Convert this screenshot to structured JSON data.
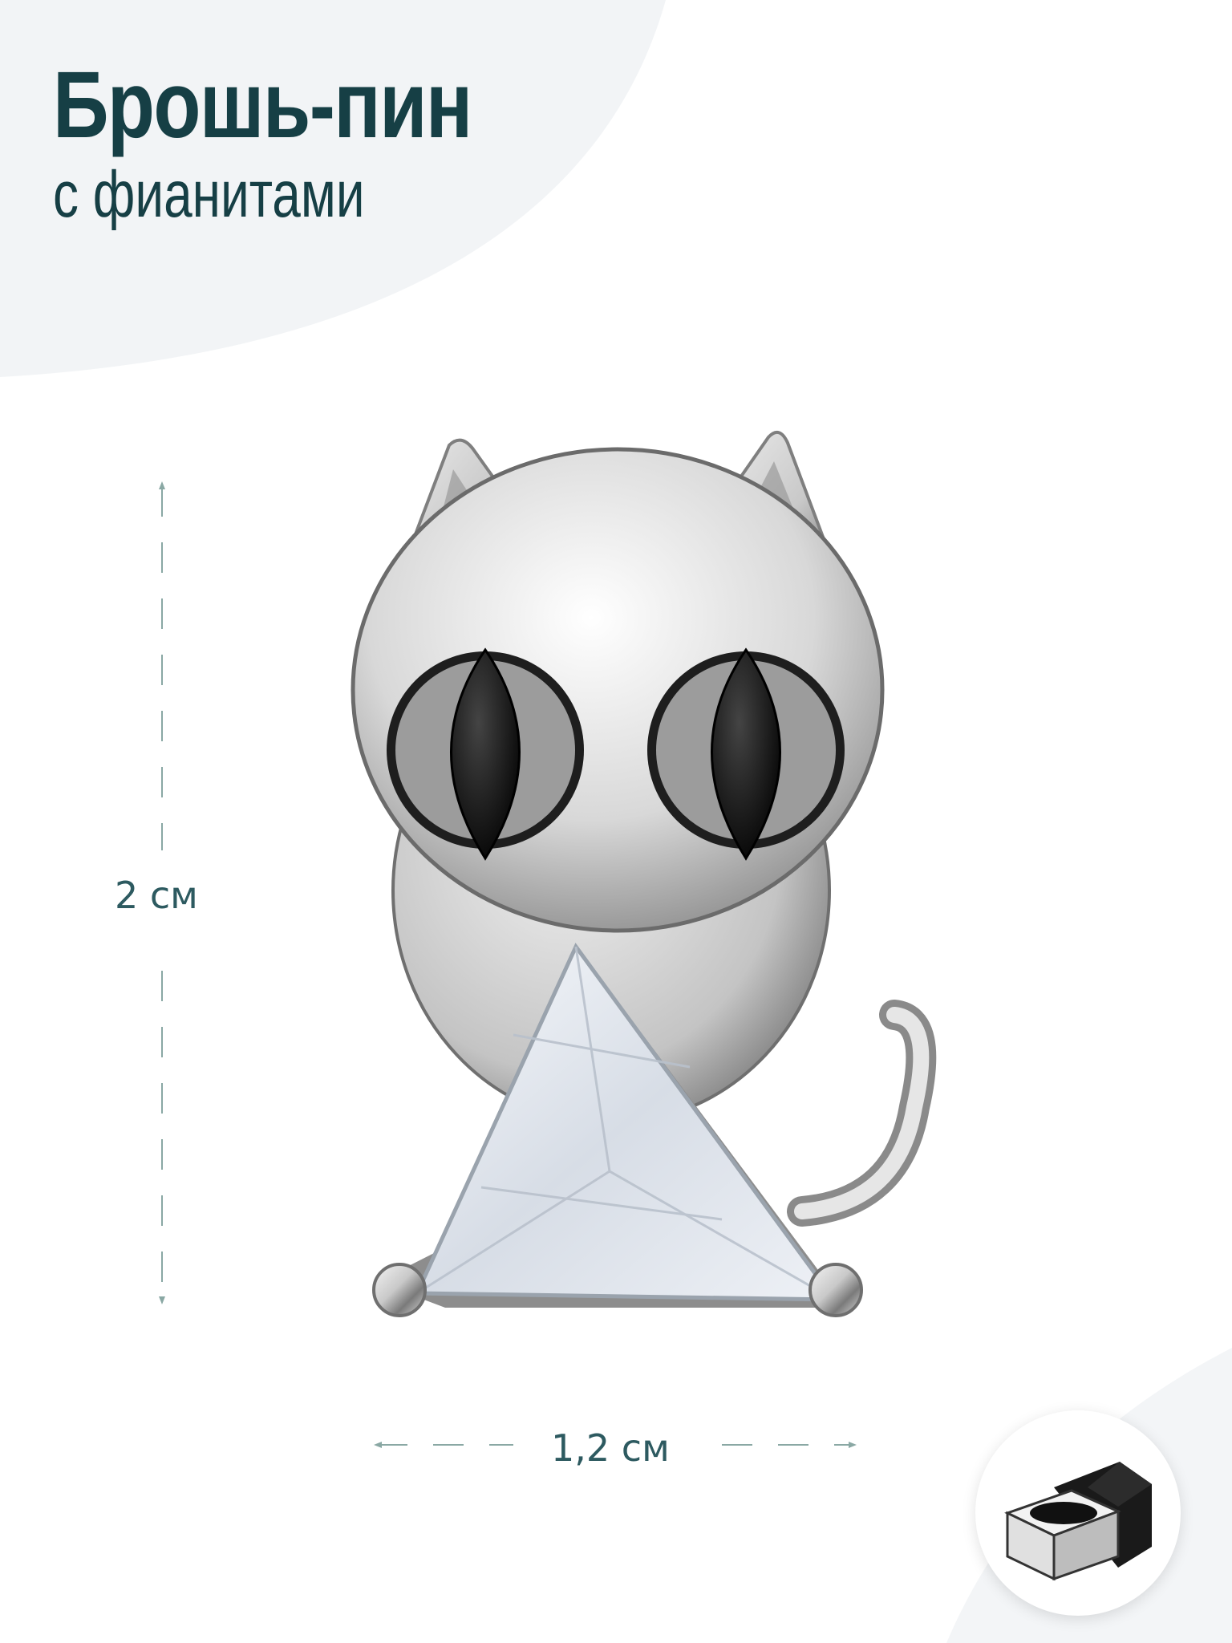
{
  "header": {
    "title": "Брошь-пин",
    "subtitle": "с фианитами"
  },
  "dimensions": {
    "height_label": "2 см",
    "width_label": "1,2 см"
  },
  "colors": {
    "title": "#163f45",
    "dimension_line": "#8aa8a4",
    "background_tint": "#f2f4f6"
  },
  "icons": {
    "product": "cat-brooch-image",
    "packaging": "gift-box-icon"
  }
}
